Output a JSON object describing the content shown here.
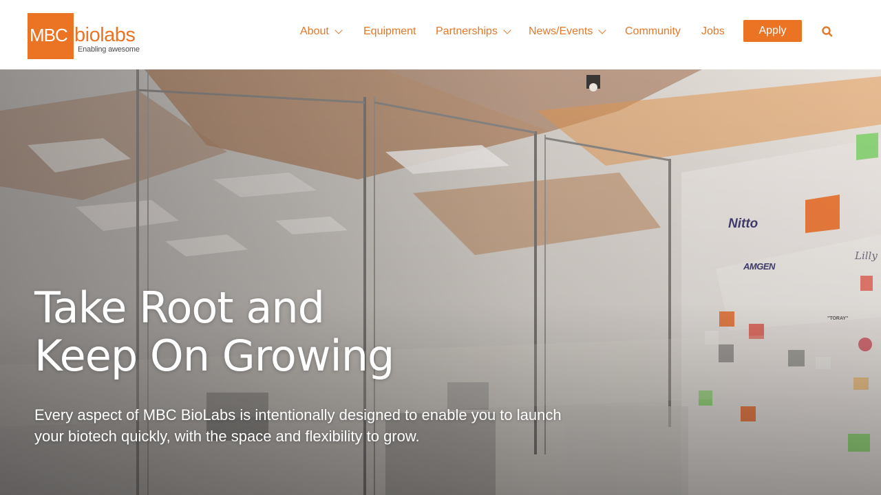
{
  "logo": {
    "mbc": "MBC",
    "biolabs": "biolabs",
    "tagline": "Enabling awesome"
  },
  "nav": {
    "about": "About",
    "equipment": "Equipment",
    "partnerships": "Partnerships",
    "news_events": "News/Events",
    "community": "Community",
    "jobs": "Jobs",
    "apply": "Apply"
  },
  "hero": {
    "title_line1": "Take Root and",
    "title_line2": "Keep On Growing",
    "subtitle": "Every aspect of MBC BioLabs is intentionally designed to enable you to launch your biotech quickly, with the space and flexibility to grow.",
    "wall_brands": {
      "nitto": "Nitto",
      "amgen": "AMGEN",
      "lilly": "Lilly",
      "toray": "\"TORAY\""
    }
  },
  "colors": {
    "brand_orange": "#ea7423",
    "nav_text": "#e4782a"
  },
  "icons": {
    "search": "search-icon",
    "chevron": "chevron-down-icon"
  }
}
